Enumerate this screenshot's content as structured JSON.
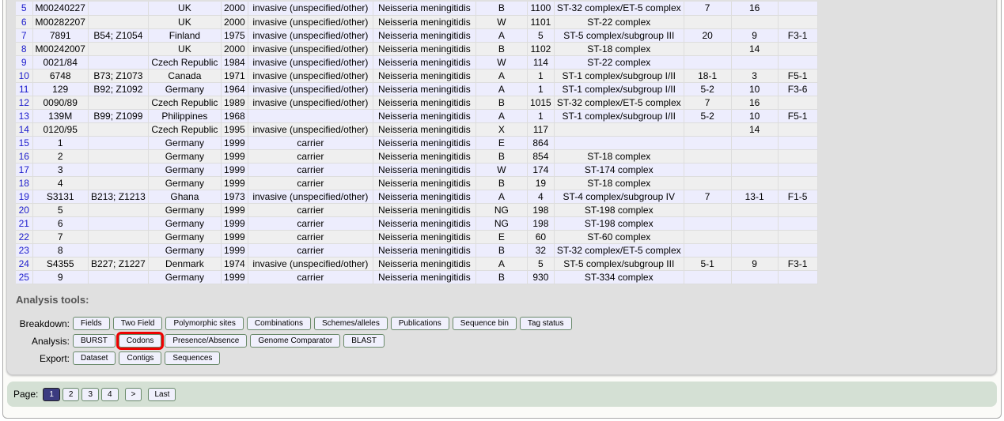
{
  "table": {
    "rows": [
      [
        "5",
        "M00240227",
        "",
        "UK",
        "2000",
        "invasive (unspecified/other)",
        "Neisseria meningitidis",
        "B",
        "1100",
        "ST-32 complex/ET-5 complex",
        "7",
        "16",
        ""
      ],
      [
        "6",
        "M00282207",
        "",
        "UK",
        "2000",
        "invasive (unspecified/other)",
        "Neisseria meningitidis",
        "W",
        "1101",
        "ST-22 complex",
        "",
        "",
        ""
      ],
      [
        "7",
        "7891",
        "B54; Z1054",
        "Finland",
        "1975",
        "invasive (unspecified/other)",
        "Neisseria meningitidis",
        "A",
        "5",
        "ST-5 complex/subgroup III",
        "20",
        "9",
        "F3-1"
      ],
      [
        "8",
        "M00242007",
        "",
        "UK",
        "2000",
        "invasive (unspecified/other)",
        "Neisseria meningitidis",
        "B",
        "1102",
        "ST-18 complex",
        "",
        "14",
        ""
      ],
      [
        "9",
        "0021/84",
        "",
        "Czech Republic",
        "1984",
        "invasive (unspecified/other)",
        "Neisseria meningitidis",
        "W",
        "114",
        "ST-22 complex",
        "",
        "",
        ""
      ],
      [
        "10",
        "6748",
        "B73; Z1073",
        "Canada",
        "1971",
        "invasive (unspecified/other)",
        "Neisseria meningitidis",
        "A",
        "1",
        "ST-1 complex/subgroup I/II",
        "18-1",
        "3",
        "F5-1"
      ],
      [
        "11",
        "129",
        "B92; Z1092",
        "Germany",
        "1964",
        "invasive (unspecified/other)",
        "Neisseria meningitidis",
        "A",
        "1",
        "ST-1 complex/subgroup I/II",
        "5-2",
        "10",
        "F3-6"
      ],
      [
        "12",
        "0090/89",
        "",
        "Czech Republic",
        "1989",
        "invasive (unspecified/other)",
        "Neisseria meningitidis",
        "B",
        "1015",
        "ST-32 complex/ET-5 complex",
        "7",
        "16",
        ""
      ],
      [
        "13",
        "139M",
        "B99; Z1099",
        "Philippines",
        "1968",
        "",
        "Neisseria meningitidis",
        "A",
        "1",
        "ST-1 complex/subgroup I/II",
        "5-2",
        "10",
        "F5-1"
      ],
      [
        "14",
        "0120/95",
        "",
        "Czech Republic",
        "1995",
        "invasive (unspecified/other)",
        "Neisseria meningitidis",
        "X",
        "117",
        "",
        "",
        "14",
        ""
      ],
      [
        "15",
        "1",
        "",
        "Germany",
        "1999",
        "carrier",
        "Neisseria meningitidis",
        "E",
        "864",
        "",
        "",
        "",
        ""
      ],
      [
        "16",
        "2",
        "",
        "Germany",
        "1999",
        "carrier",
        "Neisseria meningitidis",
        "B",
        "854",
        "ST-18 complex",
        "",
        "",
        ""
      ],
      [
        "17",
        "3",
        "",
        "Germany",
        "1999",
        "carrier",
        "Neisseria meningitidis",
        "W",
        "174",
        "ST-174 complex",
        "",
        "",
        ""
      ],
      [
        "18",
        "4",
        "",
        "Germany",
        "1999",
        "carrier",
        "Neisseria meningitidis",
        "B",
        "19",
        "ST-18 complex",
        "",
        "",
        ""
      ],
      [
        "19",
        "S3131",
        "B213; Z1213",
        "Ghana",
        "1973",
        "invasive (unspecified/other)",
        "Neisseria meningitidis",
        "A",
        "4",
        "ST-4 complex/subgroup IV",
        "7",
        "13-1",
        "F1-5"
      ],
      [
        "20",
        "5",
        "",
        "Germany",
        "1999",
        "carrier",
        "Neisseria meningitidis",
        "NG",
        "198",
        "ST-198 complex",
        "",
        "",
        ""
      ],
      [
        "21",
        "6",
        "",
        "Germany",
        "1999",
        "carrier",
        "Neisseria meningitidis",
        "NG",
        "198",
        "ST-198 complex",
        "",
        "",
        ""
      ],
      [
        "22",
        "7",
        "",
        "Germany",
        "1999",
        "carrier",
        "Neisseria meningitidis",
        "E",
        "60",
        "ST-60 complex",
        "",
        "",
        ""
      ],
      [
        "23",
        "8",
        "",
        "Germany",
        "1999",
        "carrier",
        "Neisseria meningitidis",
        "B",
        "32",
        "ST-32 complex/ET-5 complex",
        "",
        "",
        ""
      ],
      [
        "24",
        "S4355",
        "B227; Z1227",
        "Denmark",
        "1974",
        "invasive (unspecified/other)",
        "Neisseria meningitidis",
        "A",
        "5",
        "ST-5 complex/subgroup III",
        "5-1",
        "9",
        "F3-1"
      ],
      [
        "25",
        "9",
        "",
        "Germany",
        "1999",
        "carrier",
        "Neisseria meningitidis",
        "B",
        "930",
        "ST-334 complex",
        "",
        "",
        ""
      ]
    ]
  },
  "tools": {
    "title": "Analysis tools:",
    "groups": [
      {
        "label": "Breakdown:",
        "buttons": [
          "Fields",
          "Two Field",
          "Polymorphic sites",
          "Combinations",
          "Schemes/alleles",
          "Publications",
          "Sequence bin",
          "Tag status"
        ]
      },
      {
        "label": "Analysis:",
        "buttons": [
          "BURST",
          "Codons",
          "Presence/Absence",
          "Genome Comparator",
          "BLAST"
        ]
      },
      {
        "label": "Export:",
        "buttons": [
          "Dataset",
          "Contigs",
          "Sequences"
        ]
      }
    ],
    "highlighted": "Codons",
    "highlight_color": "#e00000"
  },
  "pager": {
    "label": "Page:",
    "pages": [
      "1",
      "2",
      "3",
      "4",
      ">",
      "Last"
    ],
    "current": "1"
  }
}
